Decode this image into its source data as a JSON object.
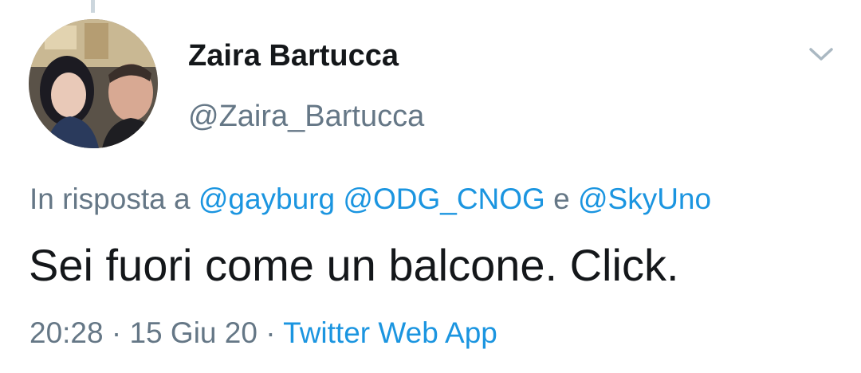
{
  "tweet": {
    "display_name": "Zaira Bartucca",
    "handle": "@Zaira_Bartucca",
    "reply": {
      "prefix": "In risposta a ",
      "mention_1": "@gayburg",
      "mention_2": "@ODG_CNOG",
      "conjunction": " e ",
      "mention_3": "@SkyUno"
    },
    "text": "Sei fuori come un balcone. Click.",
    "time": "20:28",
    "separator": " · ",
    "date": "15 Giu 20",
    "source": "Twitter Web App"
  },
  "icons": {
    "more": "chevron-down-icon",
    "avatar": "avatar-photo"
  },
  "colors": {
    "link": "#1b95e0",
    "secondary_text": "#657786",
    "primary_text": "#14171a",
    "thread_line": "#ccd6dd"
  }
}
